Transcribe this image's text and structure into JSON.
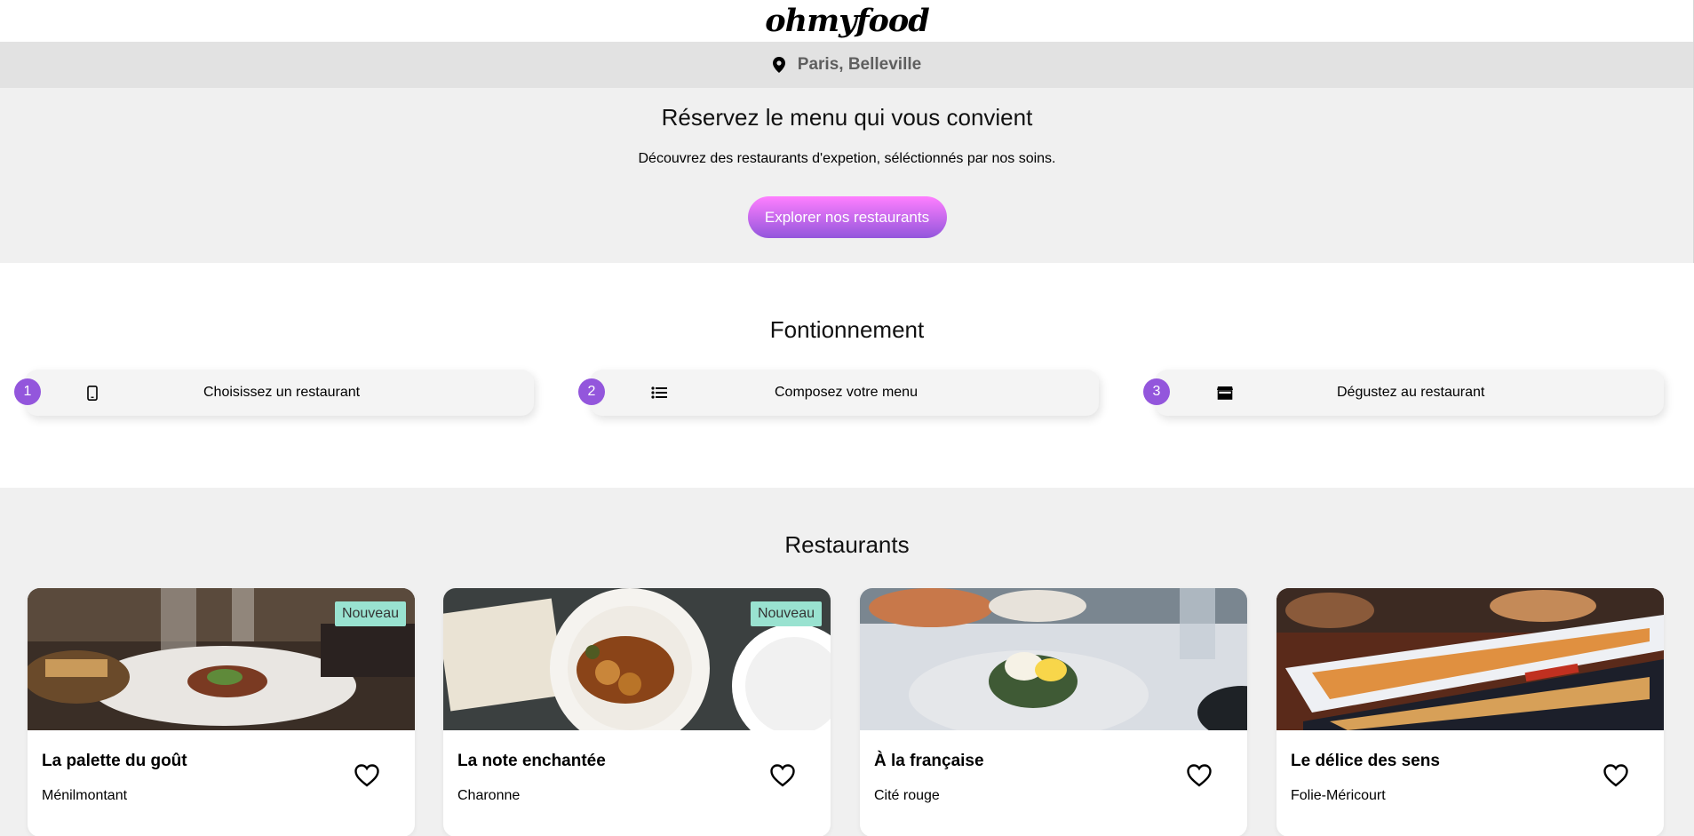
{
  "header": {
    "logo": "ohmyfood"
  },
  "location": {
    "icon": "map-pin-icon",
    "text": "Paris, Belleville"
  },
  "hero": {
    "title": "Réservez le menu qui vous convient",
    "subtitle": "Découvrez des restaurants d'expetion, séléctionnés par nos soins.",
    "button_label": "Explorer nos restaurants",
    "button_gradient": [
      "#ff7fff",
      "#9356dc"
    ]
  },
  "how": {
    "title": "Fontionnement",
    "steps": [
      {
        "number": "1",
        "icon": "smartphone-icon",
        "label": "Choisissez un restaurant"
      },
      {
        "number": "2",
        "icon": "list-icon",
        "label": "Composez votre menu"
      },
      {
        "number": "3",
        "icon": "store-icon",
        "label": "Dégustez au restaurant"
      }
    ],
    "accent": "#9356dc"
  },
  "restaurants": {
    "title": "Restaurants",
    "cards": [
      {
        "name": "La palette du goût",
        "location": "Ménilmontant",
        "badge": "Nouveau"
      },
      {
        "name": "La note enchantée",
        "location": "Charonne",
        "badge": "Nouveau"
      },
      {
        "name": "À la française",
        "location": "Cité rouge",
        "badge": ""
      },
      {
        "name": "Le délice des sens",
        "location": "Folie-Méricourt",
        "badge": ""
      }
    ],
    "badge_color": "#99e2d0"
  }
}
